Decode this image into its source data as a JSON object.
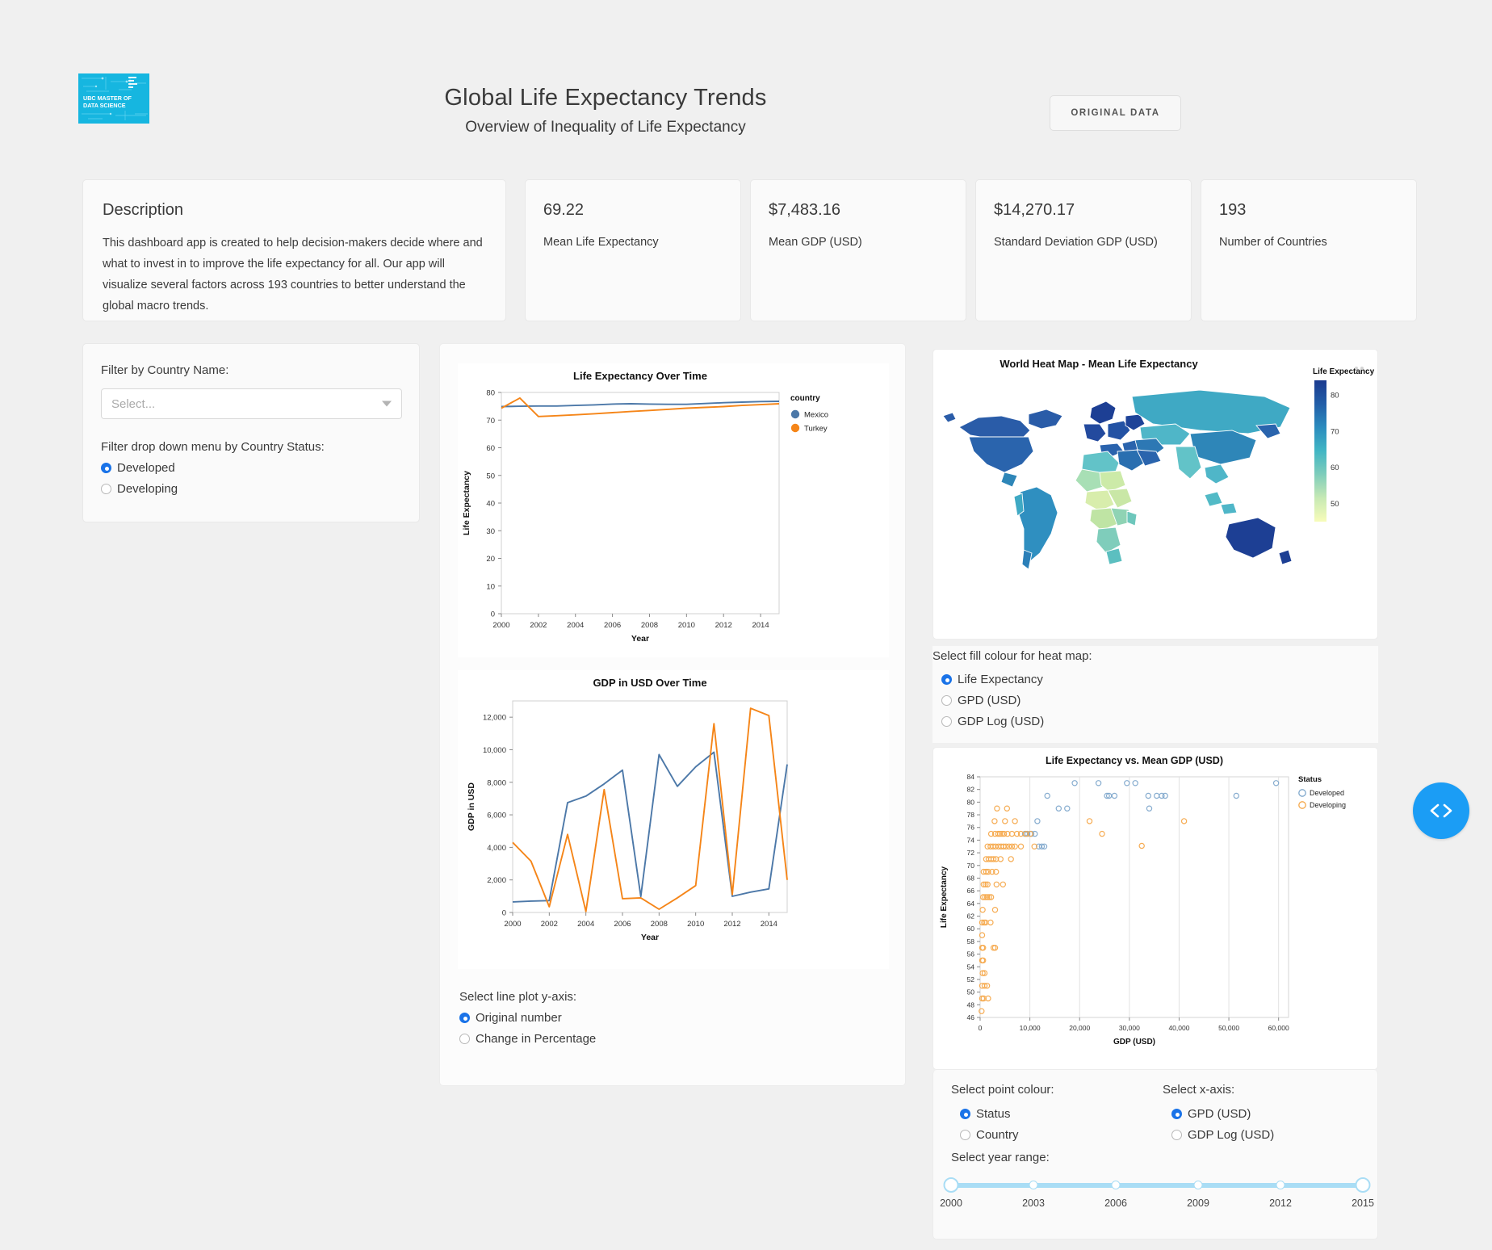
{
  "header": {
    "logo_line1": "UBC MASTER OF",
    "logo_line2": "DATA SCIENCE",
    "logo_color": "#16b6e0",
    "title": "Global Life Expectancy Trends",
    "subtitle": "Overview of Inequality of Life Expectancy",
    "original_data_button": "ORIGINAL DATA"
  },
  "description": {
    "title": "Description",
    "text": "This dashboard app is created to help decision-makers decide where and what to invest in to improve the life expectancy for all. Our app will visualize several factors across 193 countries to better understand the global macro trends."
  },
  "stats": [
    {
      "value": "69.22",
      "label": "Mean Life Expectancy"
    },
    {
      "value": "$7,483.16",
      "label": "Mean GDP (USD)"
    },
    {
      "value": "$14,270.17",
      "label": "Standard Deviation GDP (USD)"
    },
    {
      "value": "193",
      "label": "Number of Countries"
    }
  ],
  "filters": {
    "country_label": "Filter by Country Name:",
    "country_placeholder": "Select...",
    "status_label": "Filter drop down menu by Country Status:",
    "status_options": [
      "Developed",
      "Developing"
    ],
    "status_selected": "Developed"
  },
  "yaxis_control": {
    "label": "Select line plot y-axis:",
    "options": [
      "Original number",
      "Change in Percentage"
    ],
    "selected": "Original number"
  },
  "heatmap_control": {
    "label": "Select fill colour for heat map:",
    "options": [
      "Life Expectancy",
      "GPD (USD)",
      "GDP Log (USD)"
    ],
    "selected": "Life Expectancy"
  },
  "point_colour_control": {
    "label": "Select point colour:",
    "options": [
      "Status",
      "Country"
    ],
    "selected": "Status"
  },
  "xaxis_control": {
    "label": "Select x-axis:",
    "options": [
      "GPD (USD)",
      "GDP Log (USD)"
    ],
    "selected": "GPD (USD)"
  },
  "year_range": {
    "label": "Select year range:",
    "ticks": [
      "2000",
      "2003",
      "2006",
      "2009",
      "2012",
      "2015"
    ],
    "min": 2000,
    "max": 2015,
    "selected_min": 2000,
    "selected_max": 2015
  },
  "colors": {
    "mexico_blue": "#4c78a8",
    "turkey_orange": "#f58518",
    "accent_blue": "#1a73e8",
    "fab_blue": "#1b9df5",
    "slider_blue": "#a9ddf5"
  },
  "chart_data": [
    {
      "type": "line",
      "title": "Life Expectancy Over Time",
      "xlabel": "Year",
      "ylabel": "Life Expectancy",
      "legend_title": "country",
      "legend_position": "right",
      "grid": false,
      "xlim": [
        2000,
        2015
      ],
      "ylim": [
        0,
        80
      ],
      "xticks": [
        2000,
        2002,
        2004,
        2006,
        2008,
        2010,
        2012,
        2014
      ],
      "yticks": [
        0,
        10,
        20,
        30,
        40,
        50,
        60,
        70,
        80
      ],
      "x": [
        2000,
        2001,
        2002,
        2003,
        2004,
        2005,
        2006,
        2007,
        2008,
        2009,
        2010,
        2011,
        2012,
        2013,
        2014,
        2015
      ],
      "series": [
        {
          "name": "Mexico",
          "color": "#4c78a8",
          "values": [
            74.9,
            75.0,
            75.1,
            75.1,
            75.3,
            75.5,
            75.8,
            75.9,
            75.8,
            75.7,
            75.7,
            76.0,
            76.3,
            76.5,
            76.7,
            76.8
          ]
        },
        {
          "name": "Turkey",
          "color": "#f58518",
          "values": [
            74.3,
            78.0,
            71.3,
            71.6,
            71.9,
            72.3,
            72.7,
            73.1,
            73.5,
            73.9,
            74.3,
            74.6,
            74.9,
            75.3,
            75.6,
            75.9
          ]
        }
      ]
    },
    {
      "type": "line",
      "title": "GDP in USD Over Time",
      "xlabel": "Year",
      "ylabel": "GDP in USD",
      "grid": false,
      "xlim": [
        2000,
        2015
      ],
      "ylim": [
        0,
        13000
      ],
      "xticks": [
        2000,
        2002,
        2004,
        2006,
        2008,
        2010,
        2012,
        2014
      ],
      "yticks": [
        0,
        2000,
        4000,
        6000,
        8000,
        10000,
        12000
      ],
      "ytick_labels": [
        "0",
        "2,000",
        "4,000",
        "6,000",
        "8,000",
        "10,000",
        "12,000"
      ],
      "x": [
        2000,
        2001,
        2002,
        2003,
        2004,
        2005,
        2006,
        2007,
        2008,
        2009,
        2010,
        2011,
        2012,
        2013,
        2014,
        2015
      ],
      "series": [
        {
          "name": "Mexico",
          "color": "#4c78a8",
          "values": [
            650,
            700,
            730,
            6750,
            7150,
            7900,
            8750,
            980,
            9700,
            7750,
            8950,
            9850,
            990,
            1250,
            1450,
            9100
          ]
        },
        {
          "name": "Turkey",
          "color": "#f58518",
          "values": [
            4300,
            3150,
            350,
            4800,
            60,
            7550,
            850,
            900,
            200,
            900,
            1650,
            11600,
            1100,
            12550,
            12100,
            2000
          ]
        }
      ]
    },
    {
      "type": "heatmap",
      "title": "World Heat Map - Mean Life Expectancy",
      "legend_title": "Life Expectancy",
      "legend_ticks": [
        50,
        60,
        70,
        80
      ],
      "colorscale": [
        "#f7fcb9",
        "#c7e9b4",
        "#7fcdbb",
        "#41b6c4",
        "#2b8cbe",
        "#225ea8",
        "#1a3a8f"
      ],
      "vmin": 45,
      "vmax": 84
    },
    {
      "type": "scatter",
      "title": "Life Expectancy vs. Mean GDP (USD)",
      "xlabel": "GDP (USD)",
      "ylabel": "Life Expectancy",
      "legend_title": "Status",
      "legend_position": "right",
      "grid": true,
      "xlim": [
        0,
        62000
      ],
      "ylim": [
        46,
        84
      ],
      "xticks": [
        0,
        10000,
        20000,
        30000,
        40000,
        50000,
        60000
      ],
      "xtick_labels": [
        "0",
        "10,000",
        "20,000",
        "30,000",
        "40,000",
        "50,000",
        "60,000"
      ],
      "yticks": [
        46,
        48,
        50,
        52,
        54,
        56,
        58,
        60,
        62,
        64,
        66,
        68,
        70,
        72,
        74,
        76,
        78,
        80,
        82,
        84
      ],
      "series": [
        {
          "name": "Developed",
          "color": "#7fa8cc",
          "points": [
            [
              13500,
              81
            ],
            [
              19000,
              83
            ],
            [
              23800,
              83
            ],
            [
              25500,
              81
            ],
            [
              25900,
              81
            ],
            [
              29500,
              83
            ],
            [
              31200,
              83
            ],
            [
              33800,
              81
            ],
            [
              35500,
              81
            ],
            [
              36500,
              81
            ],
            [
              37200,
              81
            ],
            [
              34000,
              79
            ],
            [
              15800,
              79
            ],
            [
              17500,
              79
            ],
            [
              11500,
              77
            ],
            [
              9500,
              75
            ],
            [
              10300,
              75
            ],
            [
              11000,
              75
            ],
            [
              9000,
              75
            ],
            [
              11800,
              73
            ],
            [
              12400,
              73
            ],
            [
              12900,
              73
            ],
            [
              51500,
              81
            ],
            [
              59500,
              83
            ],
            [
              27000,
              81
            ]
          ]
        },
        {
          "name": "Developing",
          "color": "#f5a84a",
          "points": [
            [
              3400,
              79
            ],
            [
              5400,
              79
            ],
            [
              2900,
              77
            ],
            [
              5000,
              77
            ],
            [
              7000,
              77
            ],
            [
              22000,
              77
            ],
            [
              41000,
              77
            ],
            [
              2200,
              75
            ],
            [
              3000,
              75
            ],
            [
              3600,
              75
            ],
            [
              4000,
              75
            ],
            [
              4400,
              75
            ],
            [
              4800,
              75
            ],
            [
              5500,
              75
            ],
            [
              6400,
              75
            ],
            [
              7400,
              75
            ],
            [
              8200,
              75
            ],
            [
              9200,
              75
            ],
            [
              10100,
              75
            ],
            [
              24500,
              75
            ],
            [
              1500,
              73
            ],
            [
              2100,
              73
            ],
            [
              2600,
              73
            ],
            [
              3100,
              73
            ],
            [
              3700,
              73
            ],
            [
              4200,
              73
            ],
            [
              4700,
              73
            ],
            [
              5200,
              73
            ],
            [
              5800,
              73
            ],
            [
              6400,
              73
            ],
            [
              7000,
              73
            ],
            [
              8200,
              73
            ],
            [
              10900,
              73
            ],
            [
              32500,
              73.1
            ],
            [
              1200,
              71
            ],
            [
              1700,
              71
            ],
            [
              2200,
              71
            ],
            [
              2700,
              71
            ],
            [
              3200,
              71
            ],
            [
              4100,
              71
            ],
            [
              6200,
              71
            ],
            [
              700,
              69
            ],
            [
              1200,
              69
            ],
            [
              1600,
              69
            ],
            [
              2400,
              69
            ],
            [
              3200,
              69
            ],
            [
              700,
              67
            ],
            [
              1100,
              67
            ],
            [
              1500,
              67
            ],
            [
              3300,
              67
            ],
            [
              4600,
              67
            ],
            [
              600,
              65
            ],
            [
              1000,
              65
            ],
            [
              1400,
              65
            ],
            [
              1800,
              65
            ],
            [
              2200,
              65
            ],
            [
              500,
              63
            ],
            [
              3000,
              63
            ],
            [
              400,
              61
            ],
            [
              800,
              61
            ],
            [
              1100,
              61
            ],
            [
              2100,
              61
            ],
            [
              400,
              59
            ],
            [
              400,
              57
            ],
            [
              600,
              57
            ],
            [
              2700,
              57
            ],
            [
              3000,
              57
            ],
            [
              400,
              55
            ],
            [
              600,
              55
            ],
            [
              500,
              53
            ],
            [
              900,
              53
            ],
            [
              400,
              51
            ],
            [
              900,
              51
            ],
            [
              1400,
              51
            ],
            [
              400,
              49
            ],
            [
              700,
              49
            ],
            [
              1600,
              49
            ],
            [
              300,
              47
            ]
          ]
        }
      ]
    }
  ]
}
